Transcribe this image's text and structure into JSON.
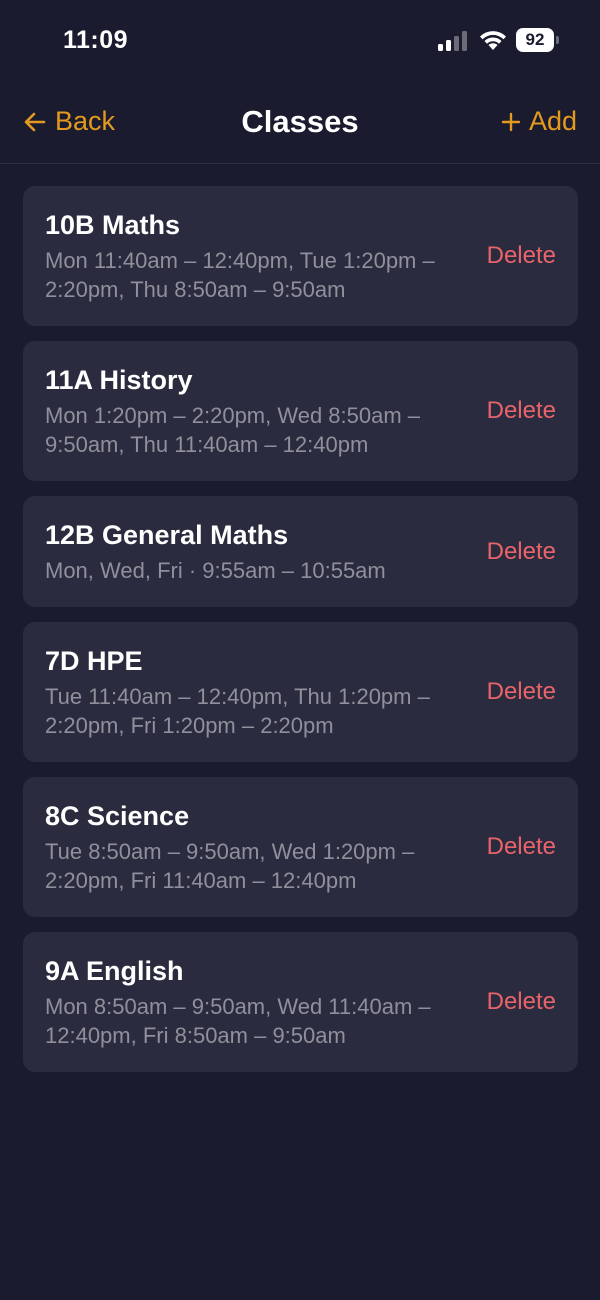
{
  "status_bar": {
    "time": "11:09",
    "battery": "92"
  },
  "nav": {
    "back_label": "Back",
    "title": "Classes",
    "add_label": "Add"
  },
  "colors": {
    "accent": "#e39a1e",
    "danger": "#e8646a",
    "background": "#1a1b2e",
    "card": "#2a2b3e",
    "muted_text": "#8f909c"
  },
  "classes": [
    {
      "name": "10B Maths",
      "schedule": "Mon 11:40am – 12:40pm, Tue 1:20pm – 2:20pm, Thu 8:50am – 9:50am",
      "delete_label": "Delete"
    },
    {
      "name": "11A History",
      "schedule": "Mon 1:20pm – 2:20pm, Wed 8:50am – 9:50am, Thu 11:40am – 12:40pm",
      "delete_label": "Delete"
    },
    {
      "name": "12B General Maths",
      "schedule": "Mon, Wed, Fri · 9:55am – 10:55am",
      "delete_label": "Delete"
    },
    {
      "name": "7D HPE",
      "schedule": "Tue 11:40am – 12:40pm, Thu 1:20pm – 2:20pm, Fri 1:20pm – 2:20pm",
      "delete_label": "Delete"
    },
    {
      "name": "8C Science",
      "schedule": "Tue 8:50am – 9:50am, Wed 1:20pm – 2:20pm, Fri 11:40am – 12:40pm",
      "delete_label": "Delete"
    },
    {
      "name": "9A English",
      "schedule": "Mon 8:50am – 9:50am, Wed 11:40am – 12:40pm, Fri 8:50am – 9:50am",
      "delete_label": "Delete"
    }
  ]
}
